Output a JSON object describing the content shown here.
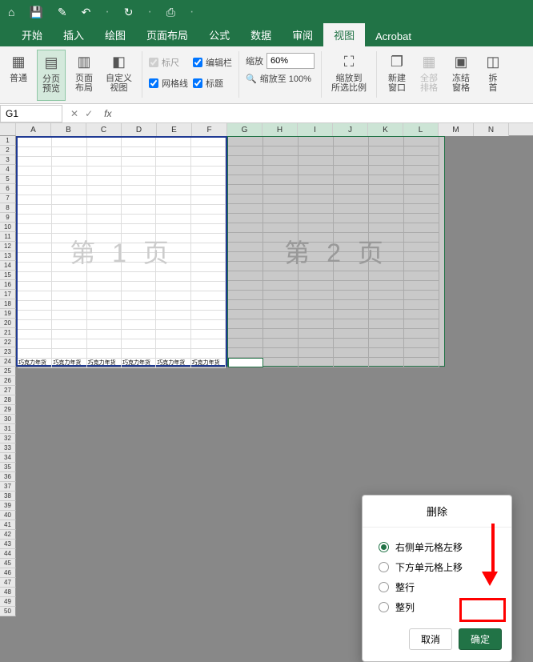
{
  "titlebar_icons": [
    "home",
    "save",
    "edit",
    "undo",
    "redo",
    "print"
  ],
  "tabs": {
    "items": [
      "开始",
      "插入",
      "绘图",
      "页面布局",
      "公式",
      "数据",
      "审阅",
      "视图",
      "Acrobat"
    ],
    "active_index": 7
  },
  "ribbon": {
    "views": [
      {
        "label": "普通"
      },
      {
        "label": "分页\n预览",
        "active": true
      },
      {
        "label": "页面\n布局"
      },
      {
        "label": "自定义\n视图"
      }
    ],
    "checks": {
      "ruler": "标尺",
      "formula_bar": "编辑栏",
      "gridlines": "网格线",
      "headings": "标题"
    },
    "zoom_label": "缩放",
    "zoom_value": "60%",
    "zoom_100": "缩放至 100%",
    "zoom_fit": "缩放到\n所选比例",
    "new_window": "新建\n窗口",
    "arrange": "全部\n排格",
    "freeze": "冻结\n窗格",
    "split": "拆\n首"
  },
  "formula": {
    "name_box": "G1",
    "fx": "fx"
  },
  "columns": [
    "A",
    "B",
    "C",
    "D",
    "E",
    "F",
    "G",
    "H",
    "I",
    "J",
    "K",
    "L",
    "M",
    "N"
  ],
  "rows_count": 50,
  "cell_value": "巧克力年货",
  "page1_label": "第 1 页",
  "page2_label": "第 2 页",
  "dialog": {
    "title": "删除",
    "options": [
      "右侧单元格左移",
      "下方单元格上移",
      "整行",
      "整列"
    ],
    "selected_index": 0,
    "cancel": "取消",
    "ok": "确定"
  }
}
